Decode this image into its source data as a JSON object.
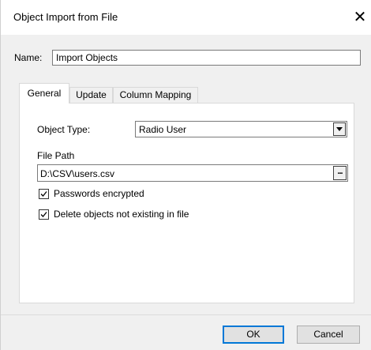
{
  "window": {
    "title": "Object Import from File",
    "close_icon": "close-icon"
  },
  "name_field": {
    "label": "Name:",
    "value": "Import Objects"
  },
  "tabs": [
    {
      "label": "General",
      "active": true
    },
    {
      "label": "Update",
      "active": false
    },
    {
      "label": "Column Mapping",
      "active": false
    }
  ],
  "general": {
    "object_type_label": "Object Type:",
    "object_type_value": "Radio User",
    "file_path_label": "File Path",
    "file_path_value": "D:\\CSV\\users.csv",
    "browse_label": "...",
    "passwords_encrypted_label": "Passwords encrypted",
    "passwords_encrypted_checked": true,
    "delete_objects_label": "Delete objects not existing in file",
    "delete_objects_checked": true
  },
  "buttons": {
    "ok": "OK",
    "cancel": "Cancel"
  },
  "colors": {
    "background": "#f0f0f0",
    "panel": "#ffffff",
    "accent": "#0078d7"
  }
}
